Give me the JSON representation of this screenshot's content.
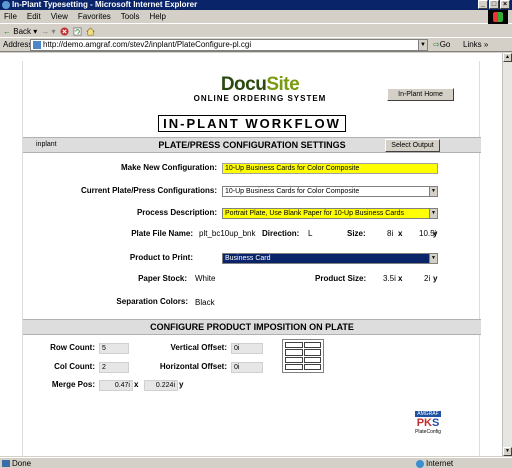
{
  "window": {
    "title": "In-Plant Typesetting - Microsoft Internet Explorer"
  },
  "menu": [
    "File",
    "Edit",
    "View",
    "Favorites",
    "Tools",
    "Help"
  ],
  "toolbar": {
    "back_label": "Back"
  },
  "address": {
    "label": "Address",
    "url": "http://demo.amgraf.com/stev2/inplant/PlateConfigure-pl.cgi",
    "go_label": "Go",
    "links_label": "Links"
  },
  "header": {
    "logo_main_a": "Docu",
    "logo_main_b": "Site",
    "logo_sub": "ONLINE ORDERING SYSTEM",
    "home_button": "In-Plant Home",
    "workflow_title": "IN-PLANT WORKFLOW"
  },
  "config": {
    "user": "inplant",
    "title": "PLATE/PRESS CONFIGURATION SETTINGS",
    "select_output_button": "Select Output",
    "make_new_label": "Make New Configuration:",
    "make_new_value": "10-Up Business Cards for Color Composite",
    "current_label": "Current Plate/Press Configurations:",
    "current_value": "10-Up Business Cards for Color Composite",
    "process_label": "Process Description:",
    "process_value": "Portrait Plate, Use Blank Paper for 10-Up Business Cards",
    "plate_file_label": "Plate File Name:",
    "plate_file_value": "plt_bc10up_bnk",
    "direction_label": "Direction:",
    "direction_value": "L",
    "size_label": "Size:",
    "size_w": "8i",
    "size_x": "x",
    "size_h": "10.5i",
    "size_y": "y",
    "product_label": "Product to Print:",
    "product_value": "Business Card",
    "paper_label": "Paper Stock:",
    "paper_value": "White",
    "product_size_label": "Product Size:",
    "product_size_w": "3.5i",
    "product_size_x": "x",
    "product_size_h": "2i",
    "product_size_y": "y",
    "separation_label": "Separation Colors:",
    "separation_value": "Black"
  },
  "imposition": {
    "title": "CONFIGURE PRODUCT IMPOSITION ON PLATE",
    "row_label": "Row Count:",
    "row_value": "5",
    "col_label": "Col Count:",
    "col_value": "2",
    "merge_label": "Merge Pos:",
    "merge_x": "0.47i",
    "merge_x_unit": "x",
    "merge_y": "0.224i",
    "merge_y_unit": "y",
    "voffset_label": "Vertical Offset:",
    "voffset_value": "0i",
    "hoffset_label": "Horizontal Offset:",
    "hoffset_value": "0i"
  },
  "badge": {
    "top": "AMGRAF",
    "pks_a": "PK",
    "pks_b": "S",
    "sub": "PlateConfig"
  },
  "status": {
    "left": "Done",
    "right": "Internet"
  }
}
